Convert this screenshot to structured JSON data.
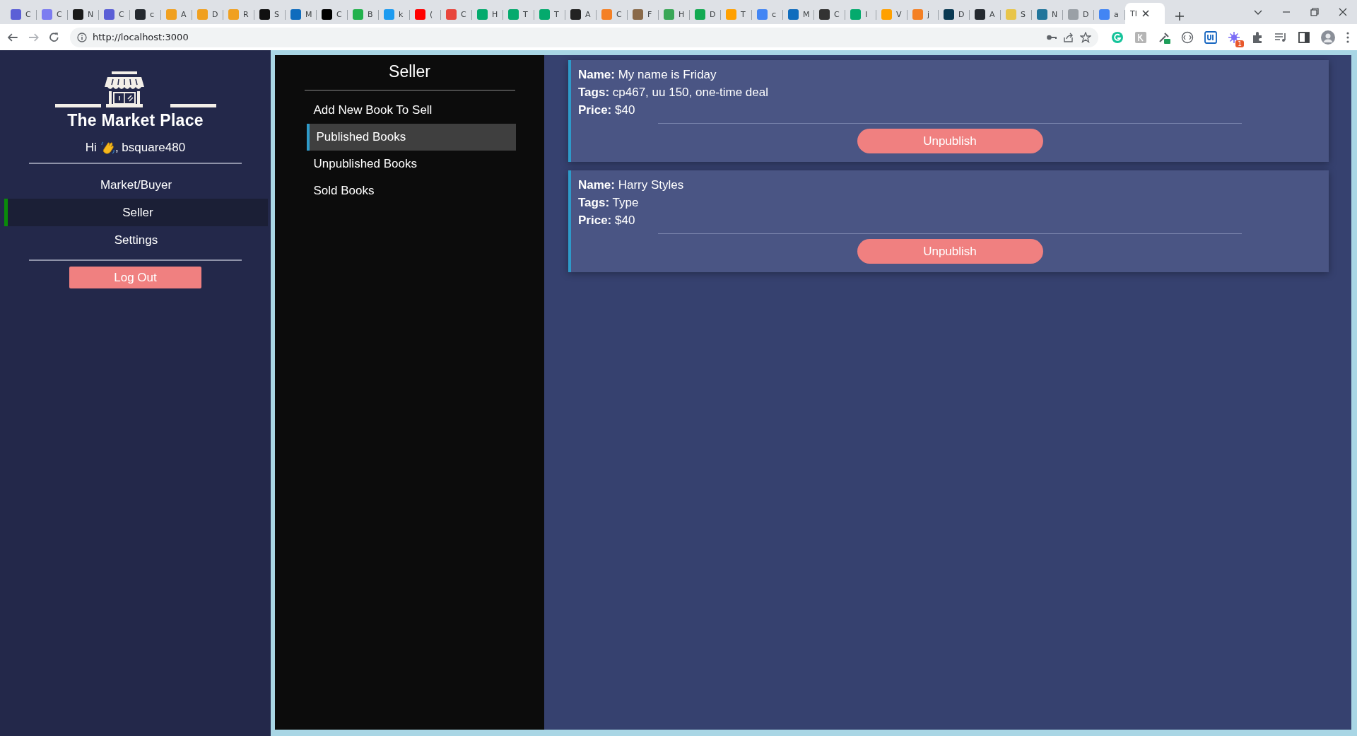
{
  "browser": {
    "tabs": [
      {
        "title": "C",
        "color": "#5b5fd6",
        "selected": false
      },
      {
        "title": "C",
        "color": "#7c7cf0",
        "selected": false
      },
      {
        "title": "N",
        "color": "#1a1a1a",
        "selected": false
      },
      {
        "title": "C",
        "color": "#5b5fd6",
        "selected": false
      },
      {
        "title": "c",
        "color": "#24292f",
        "selected": false
      },
      {
        "title": "A",
        "color": "#f0a020",
        "selected": false
      },
      {
        "title": "D",
        "color": "#f0a020",
        "selected": false
      },
      {
        "title": "R",
        "color": "#f0a020",
        "selected": false
      },
      {
        "title": "S",
        "color": "#111111",
        "selected": false
      },
      {
        "title": "M",
        "color": "#0f6cbd",
        "selected": false
      },
      {
        "title": "C",
        "color": "#000000",
        "selected": false
      },
      {
        "title": "B",
        "color": "#22b14c",
        "selected": false
      },
      {
        "title": "k",
        "color": "#1d9bf0",
        "selected": false
      },
      {
        "title": "(",
        "color": "#ff0000",
        "selected": false
      },
      {
        "title": "C",
        "color": "#e8453c",
        "selected": false
      },
      {
        "title": "H",
        "color": "#04aa6d",
        "selected": false
      },
      {
        "title": "T",
        "color": "#04aa6d",
        "selected": false
      },
      {
        "title": "T",
        "color": "#04aa6d",
        "selected": false
      },
      {
        "title": "A",
        "color": "#222222",
        "selected": false
      },
      {
        "title": "C",
        "color": "#f48024",
        "selected": false
      },
      {
        "title": "F",
        "color": "#8a6a4a",
        "selected": false
      },
      {
        "title": "H",
        "color": "#3aa757",
        "selected": false
      },
      {
        "title": "D",
        "color": "#13aa52",
        "selected": false
      },
      {
        "title": "T",
        "color": "#ffa000",
        "selected": false
      },
      {
        "title": "c",
        "color": "#4285f4",
        "selected": false
      },
      {
        "title": "M",
        "color": "#0f6cbd",
        "selected": false
      },
      {
        "title": "C",
        "color": "#333333",
        "selected": false
      },
      {
        "title": "I",
        "color": "#04aa6d",
        "selected": false
      },
      {
        "title": "V",
        "color": "#ffa000",
        "selected": false
      },
      {
        "title": "j",
        "color": "#f48024",
        "selected": false
      },
      {
        "title": "D",
        "color": "#0b3a53",
        "selected": false
      },
      {
        "title": "A",
        "color": "#24292f",
        "selected": false
      },
      {
        "title": "S",
        "color": "#e8c54a",
        "selected": false
      },
      {
        "title": "N",
        "color": "#21759b",
        "selected": false
      },
      {
        "title": "D",
        "color": "#9aa0a6",
        "selected": false
      },
      {
        "title": "a",
        "color": "#4285f4",
        "selected": false
      },
      {
        "title": "Tl",
        "color": "#ffffff",
        "selected": true
      }
    ],
    "url": "http://localhost:3000",
    "extension_badge": "1"
  },
  "sidebar": {
    "app_title": "The Market Place",
    "greeting": "Hi",
    "username": ", bsquare480",
    "items": [
      {
        "label": "Market/Buyer",
        "selected": false
      },
      {
        "label": "Seller",
        "selected": true
      },
      {
        "label": "Settings",
        "selected": false
      }
    ],
    "logout": "Log Out"
  },
  "seller_panel": {
    "title": "Seller",
    "items": [
      {
        "label": "Add New Book To Sell",
        "selected": false
      },
      {
        "label": "Published Books",
        "selected": true
      },
      {
        "label": "Unpublished Books",
        "selected": false
      },
      {
        "label": "Sold Books",
        "selected": false
      }
    ]
  },
  "books": [
    {
      "name": "**Name:** My name is Friday",
      "tags": "**Tags:** cp467, uu 150, one-time deal",
      "price": "**Price:** $40",
      "action": "Unpublish"
    },
    {
      "name": "**Name:** Harry Styles",
      "tags": "**Tags:** Type",
      "price": "**Price:** $40",
      "action": "Unpublish"
    }
  ]
}
